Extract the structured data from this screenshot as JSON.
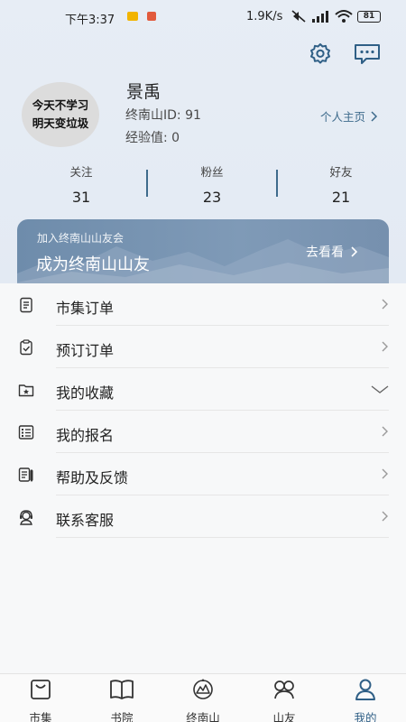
{
  "status": {
    "time": "下午3:37",
    "speed": "1.9K/s",
    "battery": "81"
  },
  "profile": {
    "avatar_line1": "今天不学习",
    "avatar_line2": "明天变垃圾",
    "name": "景禹",
    "id_label": "终南山ID: 91",
    "exp_label": "经验值: 0",
    "home_link": "个人主页"
  },
  "stats": [
    {
      "label": "关注",
      "value": "31"
    },
    {
      "label": "粉丝",
      "value": "23"
    },
    {
      "label": "好友",
      "value": "21"
    }
  ],
  "banner": {
    "subtitle": "加入终南山山友会",
    "title": "成为终南山山友",
    "action": "去看看"
  },
  "menu": [
    {
      "label": "市集订单",
      "icon": "order-doc-icon",
      "arrow": "chevron-right"
    },
    {
      "label": "预订订单",
      "icon": "booking-clipboard-icon",
      "arrow": "chevron-right"
    },
    {
      "label": "我的收藏",
      "icon": "favorite-folder-icon",
      "arrow": "chevron-down"
    },
    {
      "label": "我的报名",
      "icon": "signup-list-icon",
      "arrow": "chevron-right"
    },
    {
      "label": "帮助及反馈",
      "icon": "feedback-edit-icon",
      "arrow": "chevron-right"
    },
    {
      "label": "联系客服",
      "icon": "customer-service-icon",
      "arrow": "chevron-right"
    }
  ],
  "tabs": [
    {
      "label": "市集",
      "icon": "market-bag-icon",
      "active": false
    },
    {
      "label": "书院",
      "icon": "book-icon",
      "active": false
    },
    {
      "label": "终南山",
      "icon": "mountain-emblem-icon",
      "active": false
    },
    {
      "label": "山友",
      "icon": "friends-icon",
      "active": false
    },
    {
      "label": "我的",
      "icon": "user-icon",
      "active": true
    }
  ],
  "colors": {
    "accent": "#2f5f86",
    "link": "#3e6b8c",
    "banner": "#7f9ab7",
    "header_bg": "#e5ecf4"
  }
}
